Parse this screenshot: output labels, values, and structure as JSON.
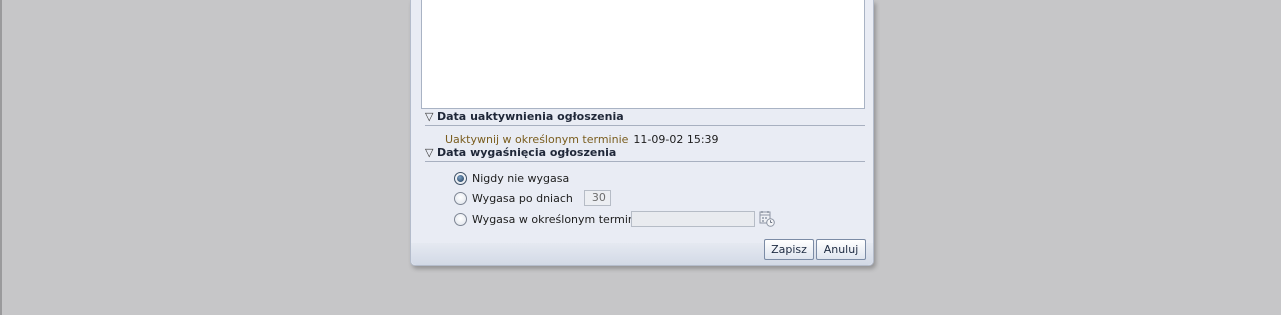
{
  "activation_section": {
    "title": "Data uaktywnienia ogłoszenia",
    "field_label": "Uaktywnij w określonym terminie",
    "field_value": "11-09-02 15:39"
  },
  "expiry_section": {
    "title": "Data wygaśnięcia ogłoszenia",
    "options": [
      {
        "label": "Nigdy nie wygasa",
        "checked": true
      },
      {
        "label": "Wygasa po dniach",
        "checked": false
      },
      {
        "label": "Wygasa w określonym terminie",
        "checked": false
      }
    ],
    "days_value": "30",
    "date_value": ""
  },
  "buttons": {
    "save_label": "Zapisz",
    "cancel_label": "Anuluj"
  },
  "icons": {
    "collapse": "triangle-down-icon",
    "calendar": "calendar-clock-icon"
  },
  "colors": {
    "background": "#c6c6c8",
    "dialog": "#e9ecf4",
    "field_label": "#7a5d1e"
  }
}
